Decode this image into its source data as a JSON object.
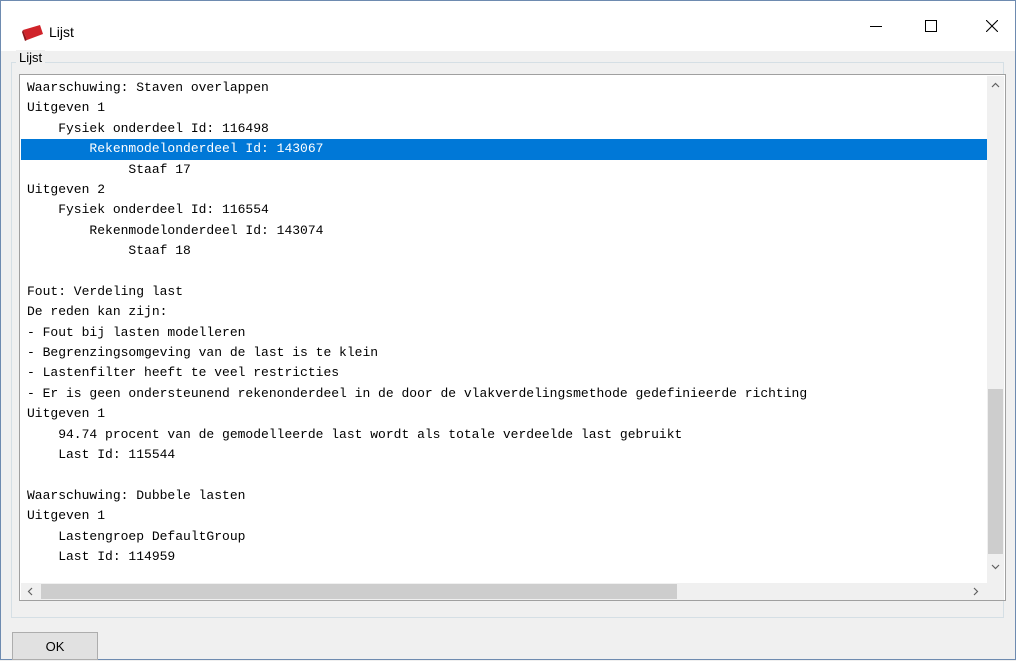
{
  "window": {
    "title": "Lijst",
    "icon": "red-flag-icon",
    "controls": [
      "minimize-icon",
      "maximize-icon",
      "close-icon"
    ]
  },
  "group": {
    "label": "Lijst"
  },
  "list": {
    "selected_index": 3,
    "selection_color": "#0078d7",
    "lines": [
      "Waarschuwing: Staven overlappen",
      "Uitgeven 1",
      "    Fysiek onderdeel Id: 116498",
      "        Rekenmodelonderdeel Id: 143067",
      "             Staaf 17",
      "Uitgeven 2",
      "    Fysiek onderdeel Id: 116554",
      "        Rekenmodelonderdeel Id: 143074",
      "             Staaf 18",
      "",
      "Fout: Verdeling last",
      "De reden kan zijn:",
      "- Fout bij lasten modelleren",
      "- Begrenzingsomgeving van de last is te klein",
      "- Lastenfilter heeft te veel restricties",
      "- Er is geen ondersteunend rekenonderdeel in de door de vlakverdelingsmethode gedefinieerde richting",
      "Uitgeven 1",
      "    94.74 procent van de gemodelleerde last wordt als totale verdeelde last gebruikt",
      "    Last Id: 115544",
      "",
      "Waarschuwing: Dubbele lasten",
      "Uitgeven 1",
      "    Lastengroep DefaultGroup",
      "    Last Id: 114959"
    ]
  },
  "buttons": {
    "ok_label": "OK"
  }
}
